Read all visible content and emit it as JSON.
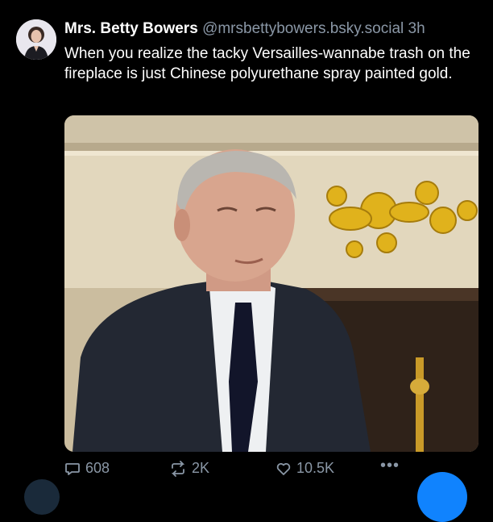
{
  "post": {
    "author_name": "Mrs. Betty Bowers",
    "author_handle": "@mrsbettybowers.bsky.social",
    "time": "3h",
    "text": "When you realize the tacky Versailles-wannabe trash on the fireplace is just Chinese polyurethane spray painted gold.",
    "avatar_icon": "avatar-portrait-icon",
    "media_icon": "embedded-photo"
  },
  "actions": {
    "reply_count": "608",
    "repost_count": "2K",
    "like_count": "10.5K",
    "more_label": "•••"
  },
  "colors": {
    "background": "#000000",
    "text_primary": "#ffffff",
    "text_secondary": "#8a97a6",
    "accent": "#1083fe"
  }
}
